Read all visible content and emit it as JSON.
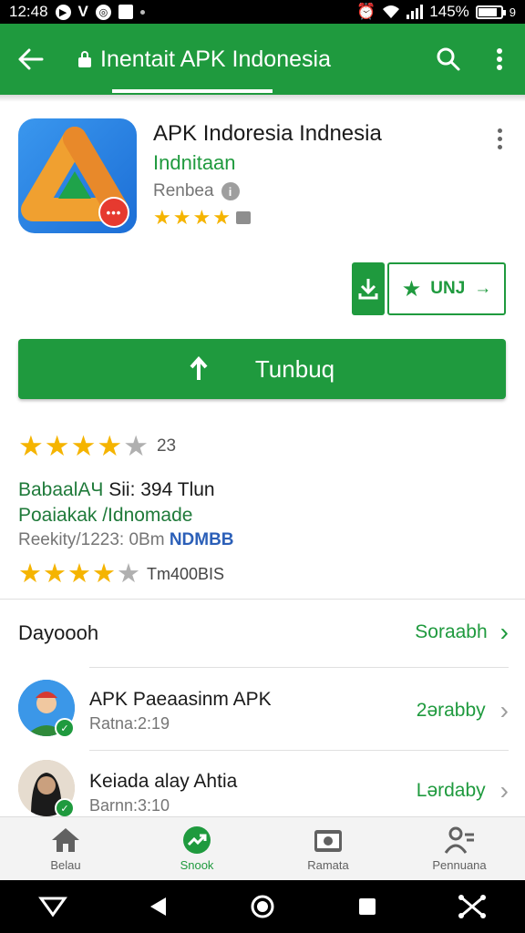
{
  "status_bar": {
    "time": "12:48",
    "battery": "145%",
    "battery_level": 0.85,
    "extra": "9"
  },
  "app_bar": {
    "title": "Inentait APK Indonesia"
  },
  "app": {
    "name": "APK Indoresia Indnesia",
    "developer": "Indnitaan",
    "category": "Renbea",
    "stars_filled": 4
  },
  "buttons": {
    "wishlist_label": "UNJ",
    "install_label": "Tunbuq"
  },
  "rating": {
    "stars_filled": 4,
    "count": "23",
    "line1_a": "BabaalAЧ",
    "line1_b": "Sii: 394 Tlun",
    "line2": "Poaiakak /Idnomade",
    "line3_a": "Reekity/1223: 0Bm",
    "line3_b": "NDMBB",
    "stars2_filled": 4,
    "line4": "Tm400BIS"
  },
  "section": {
    "title": "Dayoooh",
    "link": "Soraabh"
  },
  "list": [
    {
      "title": "APK Paeaasinm APK",
      "subtitle": "Ratna:2:19",
      "link": "2ərabby"
    },
    {
      "title": "Keiada alay Ahtia",
      "subtitle": "Barnn:3:10",
      "link": "Lərdaby"
    }
  ],
  "bottom_nav": [
    {
      "label": "Belau",
      "icon": "home-icon"
    },
    {
      "label": "Snook",
      "icon": "trending-icon"
    },
    {
      "label": "Ramata",
      "icon": "camera-icon"
    },
    {
      "label": "Pennuana",
      "icon": "people-icon"
    }
  ],
  "colors": {
    "primary": "#1f9a3e",
    "star": "#f5b400",
    "link_blue": "#2b5fb8"
  }
}
